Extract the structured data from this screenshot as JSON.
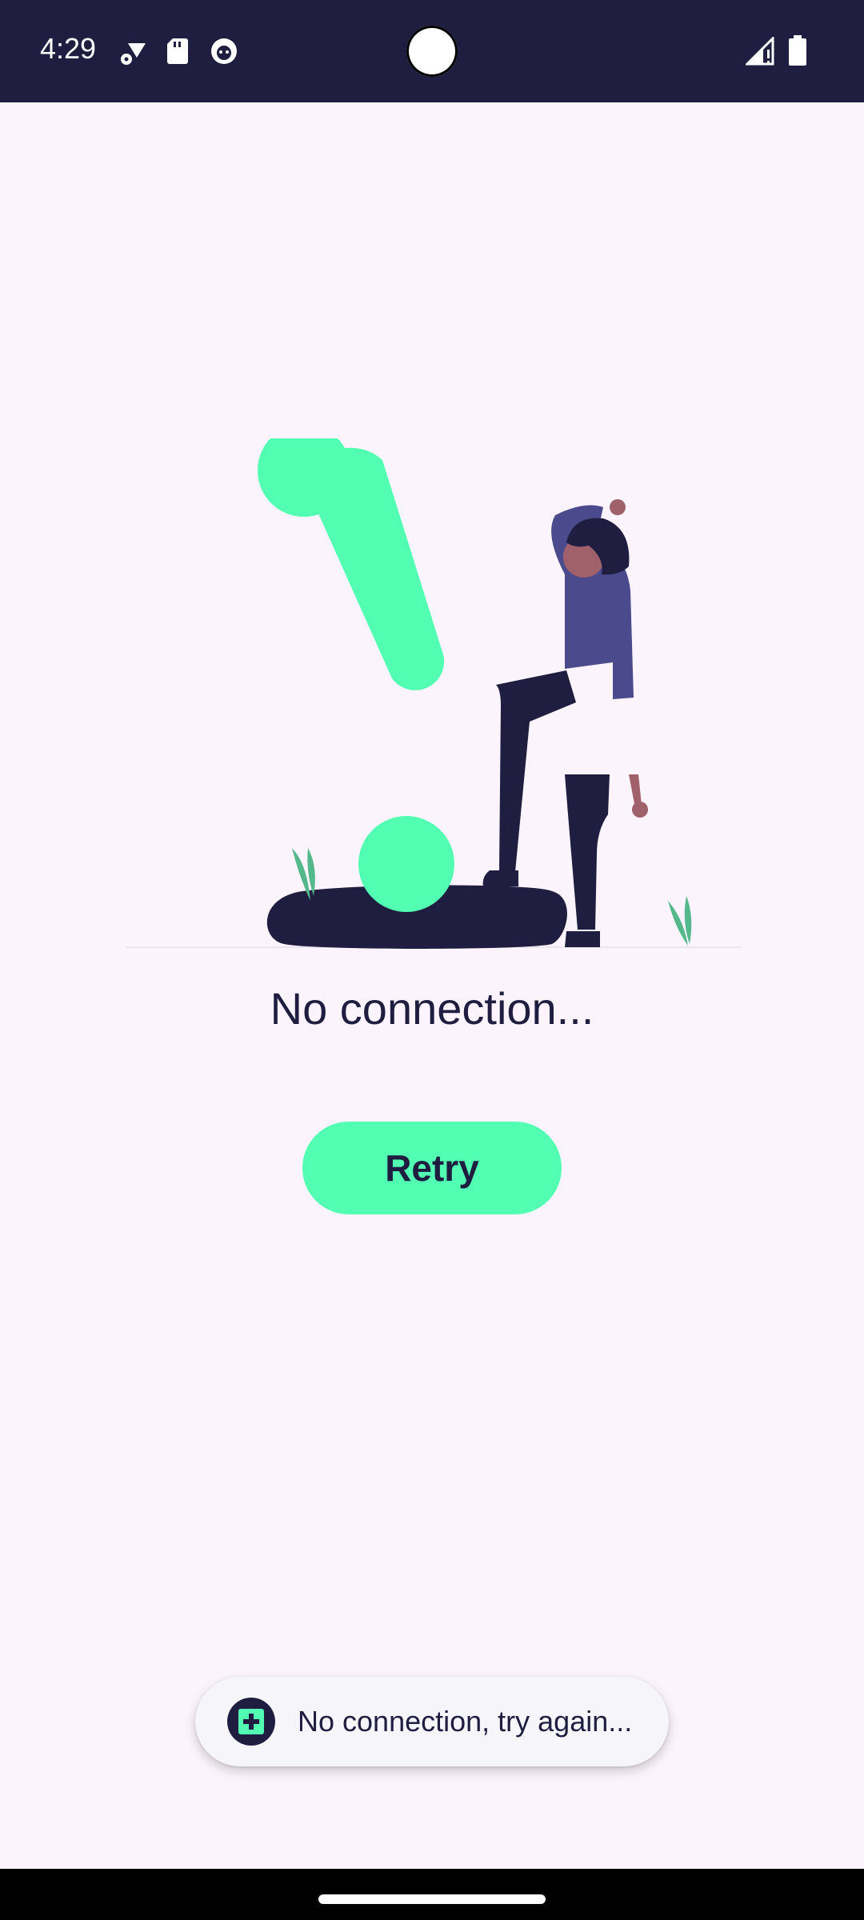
{
  "status_bar": {
    "time": "4:29",
    "icons": [
      "wifi-gear-icon",
      "sd-card-icon",
      "app-notification-icon",
      "signal-icon",
      "battery-icon"
    ]
  },
  "main": {
    "message": "No connection...",
    "retry_label": "Retry"
  },
  "toast": {
    "text": "No connection, try again...",
    "icon": "app-logo-icon"
  },
  "colors": {
    "accent": "#52ffb2",
    "dark": "#1f1e40",
    "background": "#fcf4fc",
    "person_shirt": "#4a4a8c",
    "skin": "#a0616a",
    "plant": "#53b88a"
  }
}
